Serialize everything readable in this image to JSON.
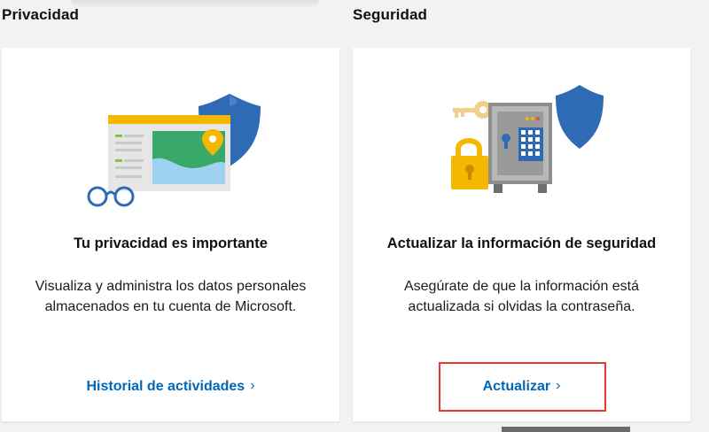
{
  "sections": [
    {
      "heading": "Privacidad",
      "card": {
        "title": "Tu privacidad es importante",
        "description": "Visualiza y administra los datos personales almacenados en tu cuenta de Microsoft.",
        "link_label": "Historial de actividades",
        "link_chevron": "›",
        "illustration": "privacy-map-shield-glasses-illustration"
      }
    },
    {
      "heading": "Seguridad",
      "card": {
        "title": "Actualizar la información de seguridad",
        "description": "Asegúrate de que la información está actualizada si olvidas la contraseña.",
        "link_label": "Actualizar",
        "link_chevron": "›",
        "illustration": "security-safe-key-lock-shield-illustration",
        "highlighted": true
      }
    }
  ],
  "colors": {
    "link": "#0067b8",
    "highlight_border": "#e53935",
    "page_background": "#f2f2f2",
    "card_background": "#ffffff",
    "shield_blue": "#2f6ab5",
    "accent_yellow": "#f5b800"
  }
}
